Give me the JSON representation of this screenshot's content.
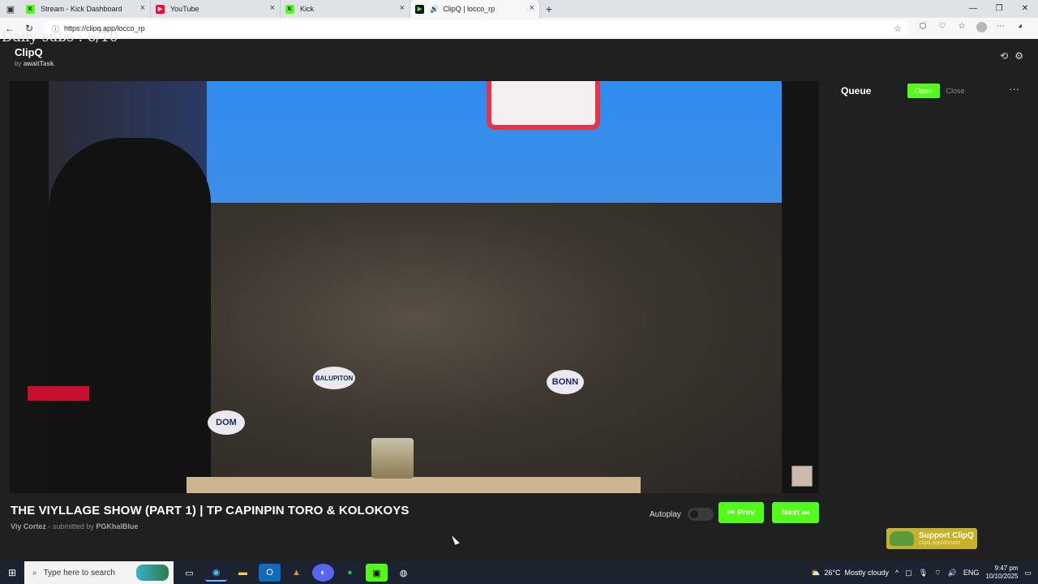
{
  "browser": {
    "tabs": [
      {
        "label": "Stream - Kick Dashboard",
        "favicon": "K",
        "color": "#53fc18",
        "active": false
      },
      {
        "label": "YouTube",
        "favicon": "▶",
        "color": "#ff0033",
        "active": false
      },
      {
        "label": "Kick",
        "favicon": "K",
        "color": "#53fc18",
        "active": false
      },
      {
        "label": "ClipQ | locco_rp",
        "favicon": "▶",
        "color": "#53fc18",
        "active": true
      }
    ],
    "url": "https://clipq.app/locco_rp"
  },
  "page": {
    "overlay_text": "Daily subs : 6/10",
    "brand_name": "ClipQ",
    "brand_by_prefix": "by",
    "brand_by_author": "awaitTask"
  },
  "video": {
    "badges": [
      "DOM",
      "BALUPITON",
      "BONN"
    ]
  },
  "clip": {
    "title": "THE VIYLLAGE SHOW (PART 1) | TP CAPINPIN TORO & KOLOKOYS",
    "creator": "Viy Cortez",
    "submitted_prefix": "- submitted by",
    "submitter": "PGKhalBlue"
  },
  "controls": {
    "autoplay_label": "Autoplay",
    "autoplay_on": false,
    "prev_label": "Prev",
    "next_label": "Next"
  },
  "queue": {
    "title": "Queue",
    "open_label": "Open",
    "close_label": "Close"
  },
  "support": {
    "label": "Support ClipQ",
    "sub": "clipq.app/donate"
  },
  "taskbar": {
    "search_placeholder": "Type here to search",
    "temperature": "26°C",
    "weather": "Mostly cloudy",
    "language": "ENG",
    "time": "9:47 pm",
    "date": "10/10/2025"
  },
  "colors": {
    "accent": "#53fc18",
    "support": "#c6b127"
  }
}
